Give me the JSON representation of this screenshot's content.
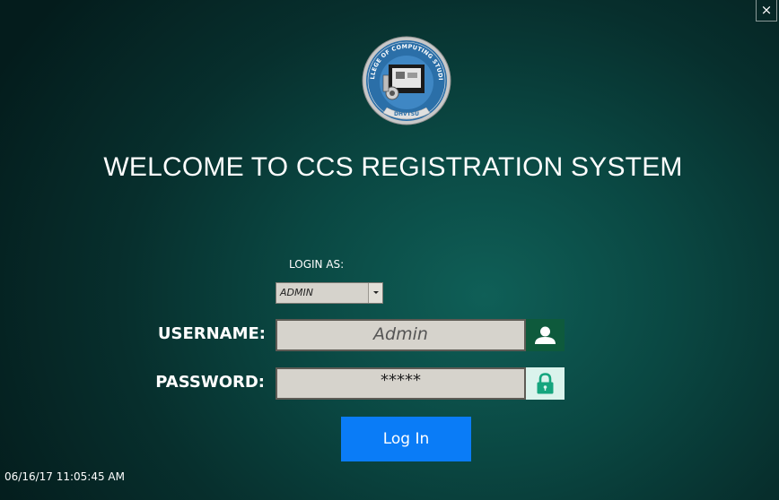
{
  "window": {
    "close_label": "×"
  },
  "logo": {
    "icon": "ccs-seal-logo",
    "text_top": "COLLEGE OF COMPUTING STUDIES",
    "text_bottom": "DHVTSU"
  },
  "header": {
    "title": "WELCOME TO CCS REGISTRATION SYSTEM"
  },
  "login": {
    "role_label": "LOGIN AS:",
    "role_value": "ADMIN",
    "username_label": "USERNAME:",
    "username_value": "Admin",
    "password_label": "PASSWORD:",
    "password_value": "*****",
    "submit_label": "Log In"
  },
  "status": {
    "timestamp": "06/16/17 11:05:45 AM"
  },
  "colors": {
    "accent": "#0a7cf7",
    "user_icon_bg": "#0e5a3c",
    "lock_icon_bg": "#daf3ec"
  }
}
